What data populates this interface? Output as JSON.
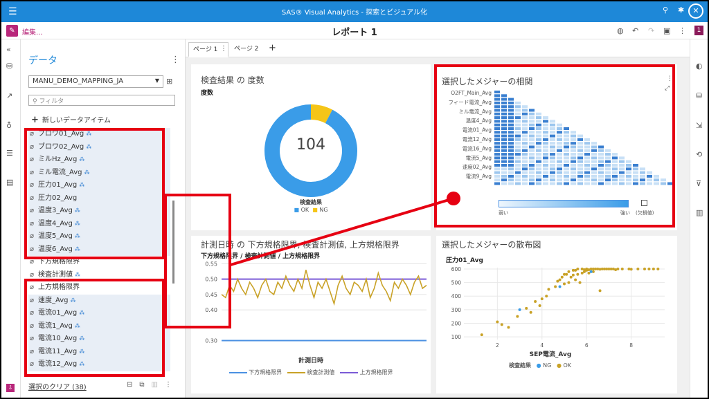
{
  "app": {
    "title": "SAS® Visual Analytics - 探索とビジュアル化"
  },
  "toolbar": {
    "edit_label": "編集...",
    "report_title": "レポート 1",
    "badge": "1"
  },
  "data_pane": {
    "title": "データ",
    "data_source": "MANU_DEMO_MAPPING_JA",
    "filter_placeholder": "フィルタ",
    "new_item_label": "新しいデータアイテム",
    "items": [
      {
        "label": "ブロワ01_Avg",
        "geo": true,
        "selected": true
      },
      {
        "label": "ブロワ02_Avg",
        "geo": true,
        "selected": true
      },
      {
        "label": "ミルHz_Avg",
        "geo": true,
        "selected": true
      },
      {
        "label": "ミル電流_Avg",
        "geo": true,
        "selected": true
      },
      {
        "label": "圧力01_Avg",
        "geo": true,
        "selected": true
      },
      {
        "label": "圧力02_Avg",
        "geo": false,
        "selected": true
      },
      {
        "label": "温度3_Avg",
        "geo": true,
        "selected": true
      },
      {
        "label": "温度4_Avg",
        "geo": true,
        "selected": true
      },
      {
        "label": "温度5_Avg",
        "geo": true,
        "selected": true
      },
      {
        "label": "温度6_Avg",
        "geo": true,
        "selected": true
      },
      {
        "label": "下方規格限界",
        "geo": false,
        "selected": false
      },
      {
        "label": "検査計測値",
        "geo": true,
        "selected": false
      },
      {
        "label": "上方規格限界",
        "geo": false,
        "selected": false
      },
      {
        "label": "速度_Avg",
        "geo": true,
        "selected": true
      },
      {
        "label": "電流01_Avg",
        "geo": true,
        "selected": true
      },
      {
        "label": "電流1_Avg",
        "geo": true,
        "selected": true
      },
      {
        "label": "電流10_Avg",
        "geo": true,
        "selected": true
      },
      {
        "label": "電流11_Avg",
        "geo": true,
        "selected": true
      },
      {
        "label": "電流12_Avg",
        "geo": true,
        "selected": true
      }
    ],
    "footer_label": "選択のクリア (38)"
  },
  "tabs": [
    {
      "label": "ページ 1",
      "active": true
    },
    {
      "label": "ページ 2",
      "active": false
    }
  ],
  "colors": {
    "brand": "#1e88d8",
    "accent": "#b8267a",
    "highlight": "#e60012",
    "ok": "#3a9ce8",
    "ng": "#f5c518",
    "measure": "#c9a227",
    "upper": "#7b5bd6",
    "lower": "#4a90e2"
  },
  "donut": {
    "title": "検査結果 の 度数",
    "subtitle": "度数",
    "center_value": "104",
    "legend_title": "検査結果",
    "legend": [
      "OK",
      "NG"
    ]
  },
  "correlation": {
    "title": "選択したメジャーの相関",
    "row_labels": [
      "O2FT_Main_Avg",
      "フィード電流_Avg",
      "ミル電流_Avg",
      "温度4_Avg",
      "電流01_Avg",
      "電流12_Avg",
      "電流16_Avg",
      "電流5_Avg",
      "速度02_Avg",
      "電流9_Avg"
    ],
    "scale_low": "弱い",
    "scale_high": "強い",
    "missing_label": "(欠損値)"
  },
  "line_chart": {
    "title": "計測日時 の 下方規格限界, 検査計測値, 上方規格限界",
    "subtitle": "下方規格限界 / 検査計測値 / 上方規格限界",
    "xlabel": "計測日時",
    "legend": [
      "下方規格限界",
      "検査計測値",
      "上方規格限界"
    ]
  },
  "scatter": {
    "title": "選択したメジャーの散布図",
    "ylabel": "圧力01_Avg",
    "xlabel": "SEP電流_Avg",
    "legend_title": "検査結果",
    "legend": [
      "NG",
      "OK"
    ]
  },
  "chart_data": [
    {
      "type": "pie",
      "title": "検査結果 の 度数",
      "categories": [
        "OK",
        "NG"
      ],
      "values": [
        96,
        8
      ],
      "total": 104
    },
    {
      "type": "line",
      "title": "計測日時 の 下方規格限界, 検査計測値, 上方規格限界",
      "xlabel": "計測日時",
      "ylabel": "下方規格限界 / 検査計測値 / 上方規格限界",
      "ylim": [
        0.29,
        0.56
      ],
      "yticks": [
        "0.30",
        "0.40",
        "0.45",
        "0.50",
        "0.55"
      ],
      "series": [
        {
          "name": "下方規格限界",
          "values": [
            0.3,
            0.3
          ]
        },
        {
          "name": "検査計測値",
          "values": [
            0.45,
            0.44,
            0.48,
            0.46,
            0.5,
            0.47,
            0.45,
            0.49,
            0.47,
            0.44,
            0.48,
            0.5,
            0.46,
            0.45,
            0.49,
            0.47,
            0.51,
            0.48,
            0.46,
            0.5,
            0.47,
            0.53,
            0.48,
            0.44,
            0.49,
            0.47,
            0.5,
            0.46,
            0.42,
            0.48,
            0.51,
            0.47,
            0.45,
            0.49,
            0.48,
            0.46,
            0.5,
            0.44,
            0.47,
            0.52,
            0.48,
            0.46,
            0.43,
            0.49,
            0.47,
            0.5,
            0.48,
            0.45,
            0.49,
            0.51,
            0.47,
            0.48
          ]
        },
        {
          "name": "上方規格限界",
          "values": [
            0.5,
            0.5
          ]
        }
      ],
      "grid": true,
      "legend_position": "bottom"
    },
    {
      "type": "scatter",
      "title": "選択したメジャーの散布図",
      "xlabel": "SEP電流_Avg",
      "ylabel": "圧力01_Avg",
      "xlim": [
        0.5,
        9.5
      ],
      "ylim": [
        80,
        610
      ],
      "xticks": [
        "2",
        "4",
        "6",
        "8"
      ],
      "yticks": [
        "100",
        "200",
        "300",
        "400",
        "500",
        "600"
      ],
      "series": [
        {
          "name": "OK",
          "points": [
            [
              1.3,
              115
            ],
            [
              2.0,
              210
            ],
            [
              2.2,
              190
            ],
            [
              2.5,
              170
            ],
            [
              2.9,
              250
            ],
            [
              3.3,
              310
            ],
            [
              3.7,
              360
            ],
            [
              3.9,
              330
            ],
            [
              4.2,
              400
            ],
            [
              4.3,
              450
            ],
            [
              4.6,
              470
            ],
            [
              4.8,
              520
            ],
            [
              4.9,
              540
            ],
            [
              5.0,
              490
            ],
            [
              5.2,
              500
            ],
            [
              5.3,
              540
            ],
            [
              5.4,
              555
            ],
            [
              5.5,
              520
            ],
            [
              5.6,
              560
            ],
            [
              5.7,
              500
            ],
            [
              5.8,
              570
            ],
            [
              5.9,
              580
            ],
            [
              5.2,
              580
            ],
            [
              5.4,
              590
            ],
            [
              5.6,
              600
            ],
            [
              5.8,
              600
            ],
            [
              6.0,
              600
            ],
            [
              6.1,
              595
            ],
            [
              6.2,
              600
            ],
            [
              6.3,
              600
            ],
            [
              6.4,
              600
            ],
            [
              6.5,
              600
            ],
            [
              6.6,
              598
            ],
            [
              6.7,
              600
            ],
            [
              6.8,
              600
            ],
            [
              6.9,
              600
            ],
            [
              7.0,
              600
            ],
            [
              7.1,
              600
            ],
            [
              7.2,
              600
            ],
            [
              7.4,
              600
            ],
            [
              7.6,
              600
            ],
            [
              7.9,
              600
            ],
            [
              8.3,
              600
            ],
            [
              8.6,
              600
            ],
            [
              8.8,
              600
            ],
            [
              9.0,
              600
            ],
            [
              9.2,
              600
            ],
            [
              5.5,
              590
            ],
            [
              5.9,
              595
            ],
            [
              6.1,
              570
            ],
            [
              6.3,
              580
            ],
            [
              4.7,
              510
            ],
            [
              5.1,
              560
            ],
            [
              6.6,
              440
            ],
            [
              4.0,
              380
            ],
            [
              3.5,
              280
            ],
            [
              5.0,
              560
            ],
            [
              6.0,
              590
            ],
            [
              7.3,
              595
            ],
            [
              8.0,
              598
            ]
          ]
        },
        {
          "name": "NG",
          "points": [
            [
              3.0,
              300
            ],
            [
              4.8,
              470
            ],
            [
              6.2,
              580
            ]
          ]
        }
      ],
      "grid": true,
      "legend_position": "bottom"
    }
  ]
}
